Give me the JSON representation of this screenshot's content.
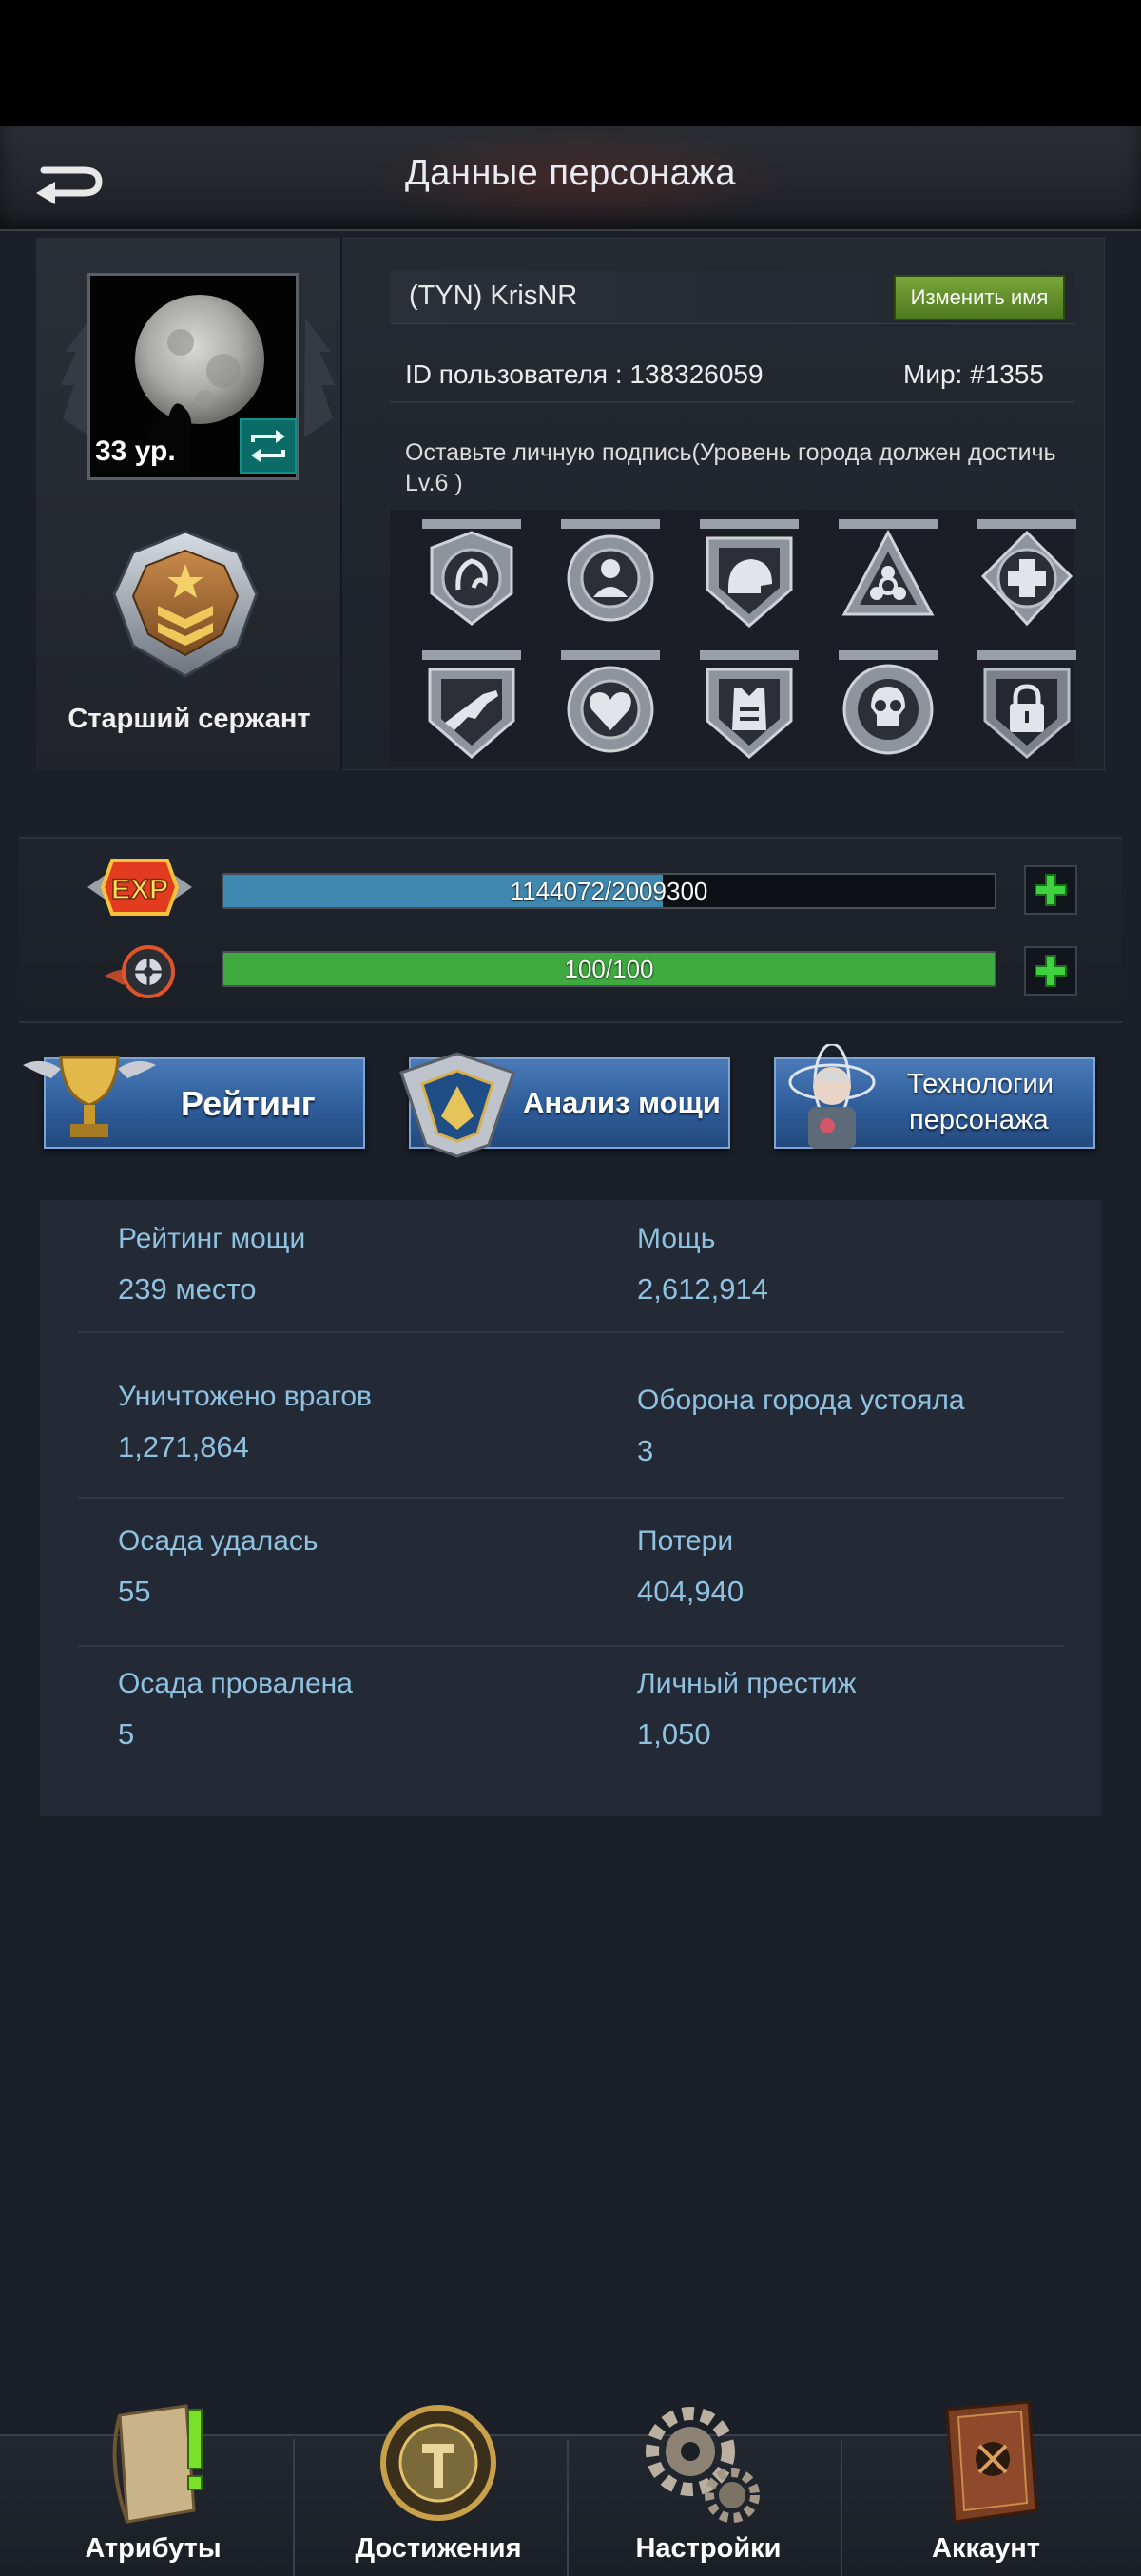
{
  "header": {
    "title": "Данные персонажа"
  },
  "profile": {
    "level_text": "33 ур.",
    "rank_name": "Старший сержант",
    "player_name": "(TYN) KrisNR",
    "rename_button": "Изменить имя",
    "id_label": "ID пользователя  : 138326059",
    "world_label": "Мир: #1355",
    "signature": "Оставьте личную подпись(Уровень города должен достичь Lv.6 )"
  },
  "badges": [
    {
      "icon": "mammoth-badge-icon"
    },
    {
      "icon": "soldier-badge-icon"
    },
    {
      "icon": "helmet-badge-icon"
    },
    {
      "icon": "biohazard-badge-icon"
    },
    {
      "icon": "medic-cross-badge-icon"
    },
    {
      "icon": "rifle-badge-icon"
    },
    {
      "icon": "heart-badge-icon"
    },
    {
      "icon": "armor-vest-badge-icon"
    },
    {
      "icon": "skull-badge-icon"
    },
    {
      "icon": "lock-badge-icon"
    }
  ],
  "bars": {
    "exp": {
      "icon": "exp-icon",
      "current": 1144072,
      "max": 2009300,
      "text": "1144072/2009300",
      "color": "#3f88b0"
    },
    "energy": {
      "icon": "energy-wheel-icon",
      "current": 100,
      "max": 100,
      "text": "100/100",
      "color": "#3faa3f"
    }
  },
  "nav_buttons": {
    "rating": "Рейтинг",
    "power_analysis": "Анализ мощи",
    "tech_line1": "Технологии",
    "tech_line2": "персонажа"
  },
  "stats": [
    {
      "label": "Рейтинг мощи",
      "value": "239 место"
    },
    {
      "label": "Мощь",
      "value": "2,612,914"
    },
    {
      "label": "Уничтожено врагов",
      "value": "1,271,864"
    },
    {
      "label": "Оборона города устояла",
      "value": "3"
    },
    {
      "label": "Осада удалась",
      "value": "55"
    },
    {
      "label": "Потери",
      "value": "404,940"
    },
    {
      "label": "Осада провалена",
      "value": "5"
    },
    {
      "label": "Личный престиж",
      "value": "1,050"
    }
  ],
  "bottom_nav": [
    {
      "label": "Атрибуты",
      "icon": "attributes-scroll-icon"
    },
    {
      "label": "Достижения",
      "icon": "achievements-medal-icon"
    },
    {
      "label": "Настройки",
      "icon": "settings-gears-icon"
    },
    {
      "label": "Аккаунт",
      "icon": "account-book-icon"
    }
  ],
  "colors": {
    "stat_text": "#8fc1e0",
    "nav_button": "#2e5d9a",
    "rename_button": "#5f8f2a",
    "plus_icon": "#3fd23f"
  }
}
